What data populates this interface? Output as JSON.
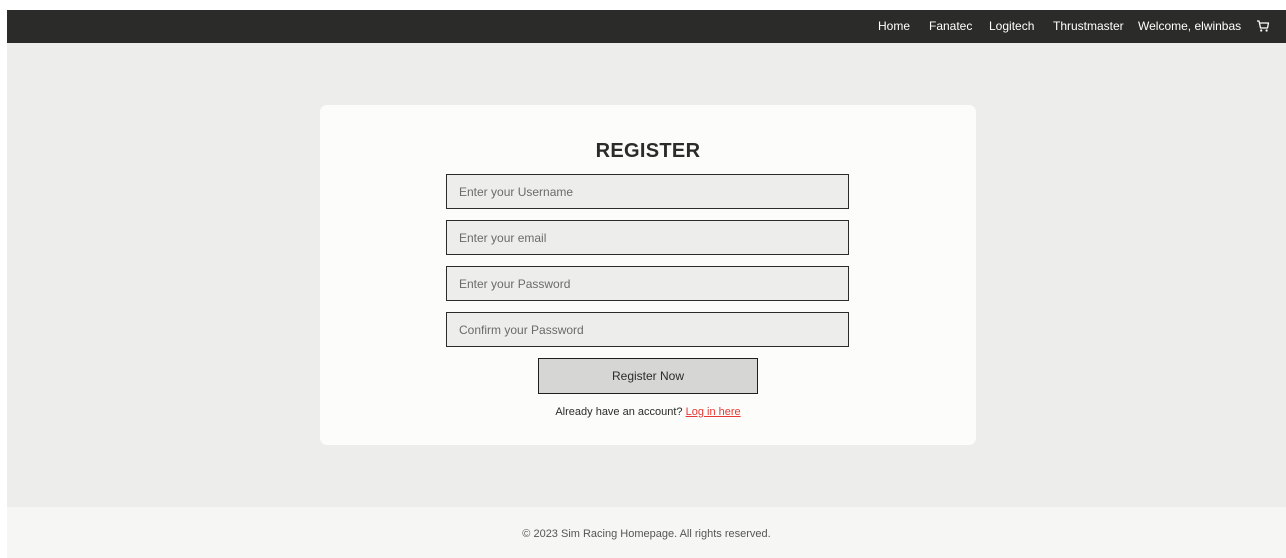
{
  "nav": {
    "items": [
      {
        "label": "Home"
      },
      {
        "label": "Fanatec"
      },
      {
        "label": "Logitech"
      },
      {
        "label": "Thrustmaster"
      }
    ],
    "welcome": "Welcome, elwinbas",
    "cart_icon": "cart-icon"
  },
  "form": {
    "title": "REGISTER",
    "username": {
      "value": "",
      "placeholder": "Enter your Username"
    },
    "email": {
      "value": "",
      "placeholder": "Enter your email"
    },
    "password": {
      "value": "",
      "placeholder": "Enter your Password"
    },
    "confirm_password": {
      "value": "",
      "placeholder": "Confirm your Password"
    },
    "submit_label": "Register Now",
    "login_prompt": "Already have an account?",
    "login_link": "Log in here"
  },
  "footer": {
    "text": "© 2023 Sim Racing Homepage. All rights reserved."
  },
  "colors": {
    "navbar": "#2b2b29",
    "page_background": "#ededeb",
    "card": "#fcfcfa",
    "link": "#e53935"
  }
}
